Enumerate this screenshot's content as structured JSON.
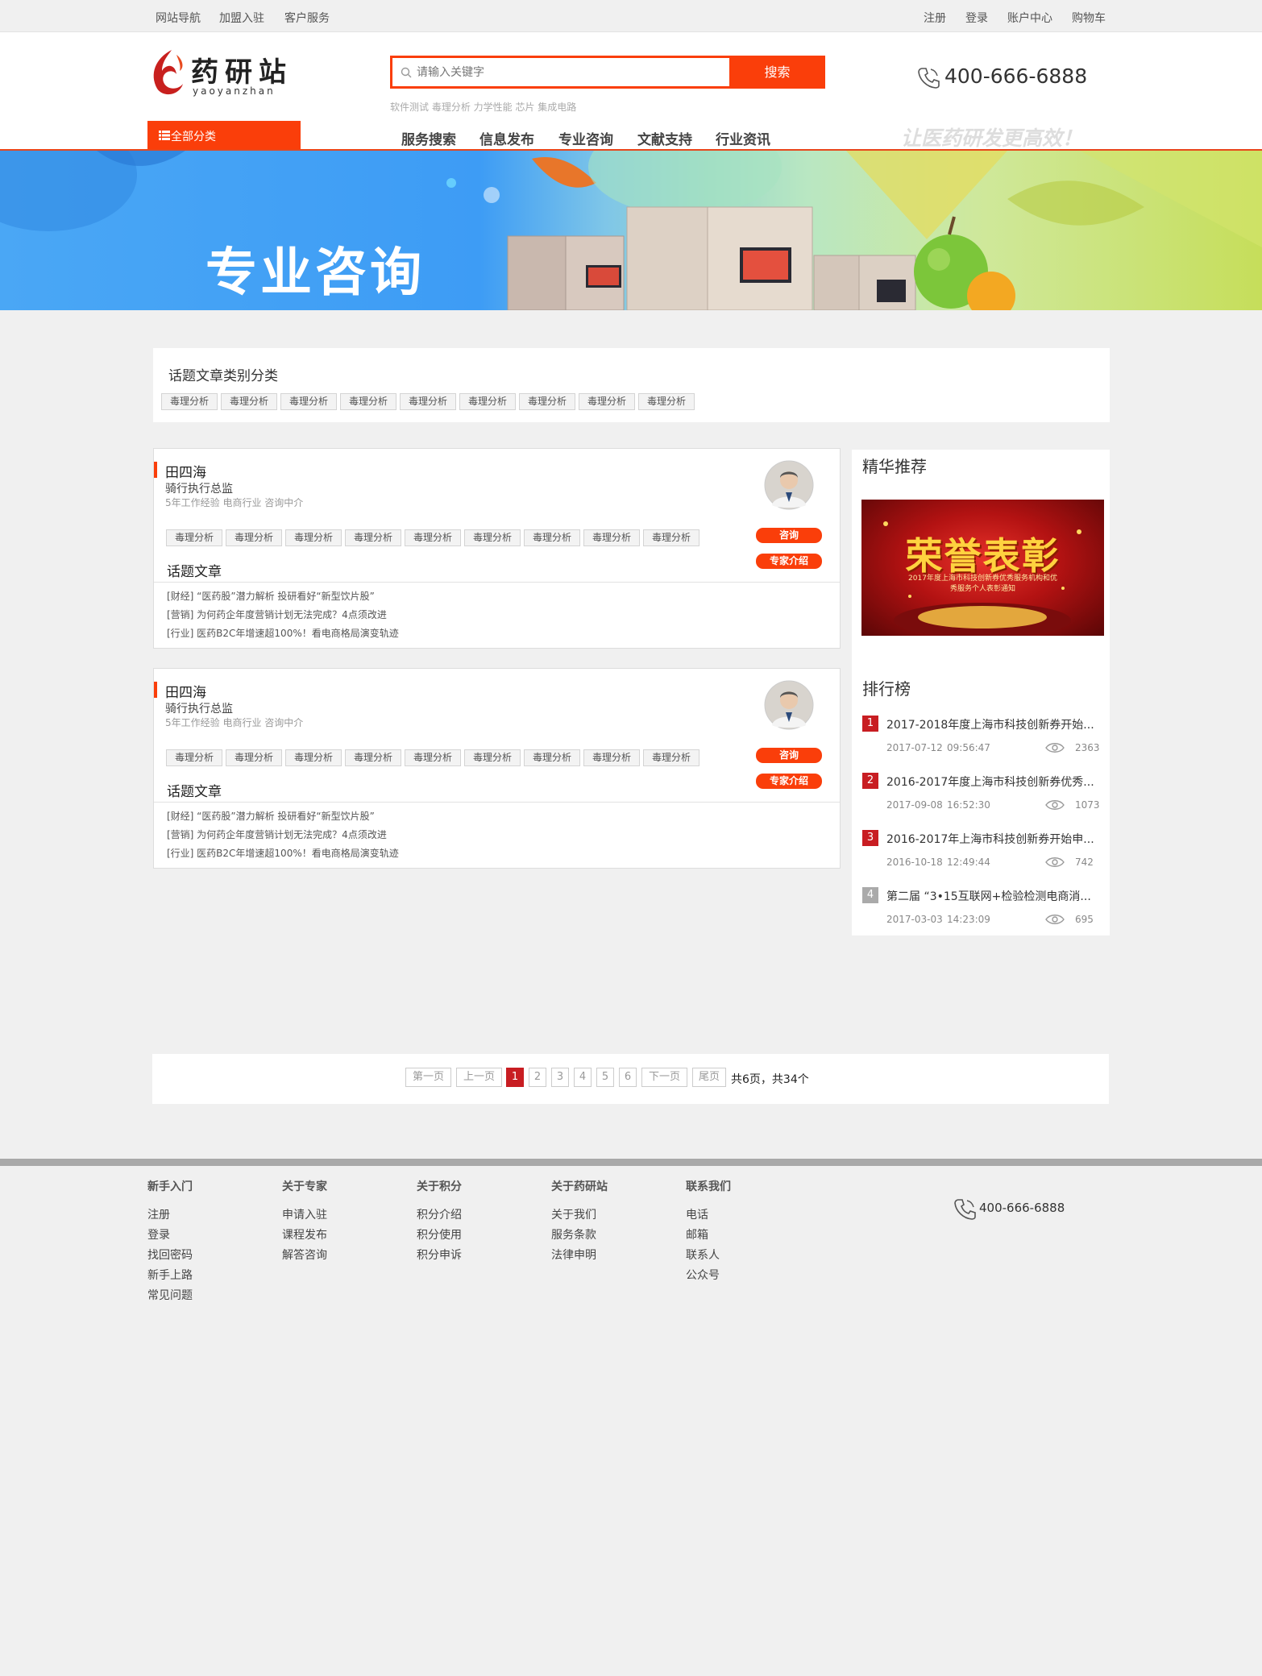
{
  "topbar": {
    "left": [
      "网站导航",
      "加盟入驻",
      "客户服务"
    ],
    "right": [
      "注册",
      "登录",
      "账户中心",
      "购物车"
    ]
  },
  "header": {
    "logo_cn": "药研站",
    "logo_en": "yaoyanzhan",
    "search_placeholder": "请输入关键字",
    "search_button": "搜索",
    "hot_keywords": "软件测试 毒理分析 力学性能 芯片 集成电路",
    "phone": "400-666-6888",
    "slogan": "让医药研发更高效！",
    "all_categories": "全部分类",
    "nav": [
      "服务搜索",
      "信息发布",
      "专业咨询",
      "文献支持",
      "行业资讯"
    ]
  },
  "banner": {
    "title": "专业咨询"
  },
  "category_box": {
    "title": "话题文章类别分类",
    "tags": [
      "毒理分析",
      "毒理分析",
      "毒理分析",
      "毒理分析",
      "毒理分析",
      "毒理分析",
      "毒理分析",
      "毒理分析",
      "毒理分析"
    ]
  },
  "experts": [
    {
      "name": "田四海",
      "title": "骑行执行总监",
      "meta": "5年工作经验 电商行业 咨询中介",
      "tags": [
        "毒理分析",
        "毒理分析",
        "毒理分析",
        "毒理分析",
        "毒理分析",
        "毒理分析",
        "毒理分析",
        "毒理分析",
        "毒理分析"
      ],
      "consult": "咨询",
      "intro": "专家介绍",
      "articles_title": "话题文章",
      "articles": [
        "[财经] “医药股”潜力解析 投研看好“新型饮片股”",
        "[营销] 为何药企年度营销计划无法完成？4点须改进",
        "[行业] 医药B2C年增速超100%！看电商格局演变轨迹"
      ]
    },
    {
      "name": "田四海",
      "title": "骑行执行总监",
      "meta": "5年工作经验 电商行业 咨询中介",
      "tags": [
        "毒理分析",
        "毒理分析",
        "毒理分析",
        "毒理分析",
        "毒理分析",
        "毒理分析",
        "毒理分析",
        "毒理分析",
        "毒理分析"
      ],
      "consult": "咨询",
      "intro": "专家介绍",
      "articles_title": "话题文章",
      "articles": [
        "[财经] “医药股”潜力解析 投研看好“新型饮片股”",
        "[营销] 为何药企年度营销计划无法完成？4点须改进",
        "[行业] 医药B2C年增速超100%！看电商格局演变轨迹"
      ]
    }
  ],
  "sidebar": {
    "featured_title": "精华推荐",
    "featured_banner_text": "荣誉表彰",
    "featured_banner_sub": "2017年度上海市科技创新券优秀服务机构和优秀服务个人表彰通知",
    "ranking_title": "排行榜",
    "ranking": [
      {
        "rank": "1",
        "title": "2017-2018年度上海市科技创新券开始...",
        "date": "2017-07-12",
        "time": "09:56:47",
        "views": "2363"
      },
      {
        "rank": "2",
        "title": "2016-2017年度上海市科技创新券优秀...",
        "date": "2017-09-08",
        "time": "16:52:30",
        "views": "1073"
      },
      {
        "rank": "3",
        "title": "2016-2017年上海市科技创新券开始申...",
        "date": "2016-10-18",
        "time": "12:49:44",
        "views": "742"
      },
      {
        "rank": "4",
        "title": "第二届 “3•15互联网+检验检测电商消...",
        "date": "2017-03-03",
        "time": "14:23:09",
        "views": "695"
      }
    ],
    "rank_colors": [
      "#c81d22",
      "#c81d22",
      "#c81d22",
      "#aaaaaa"
    ]
  },
  "pagination": {
    "first": "第一页",
    "prev": "上一页",
    "pages": [
      "1",
      "2",
      "3",
      "4",
      "5",
      "6"
    ],
    "next": "下一页",
    "last": "尾页",
    "summary": "共6页，共34个"
  },
  "footer": {
    "columns": [
      {
        "title": "新手入门",
        "links": [
          "注册",
          "登录",
          "找回密码",
          "新手上路",
          "常见问题"
        ]
      },
      {
        "title": "关于专家",
        "links": [
          "申请入驻",
          "课程发布",
          "解答咨询"
        ]
      },
      {
        "title": "关于积分",
        "links": [
          "积分介绍",
          "积分使用",
          "积分申诉"
        ]
      },
      {
        "title": "关于药研站",
        "links": [
          "关于我们",
          "服务条款",
          "法律申明"
        ]
      },
      {
        "title": "联系我们",
        "links": [
          "电话",
          "邮箱",
          "联系人",
          "公众号"
        ]
      }
    ],
    "phone": "400-666-6888"
  },
  "colors": {
    "accent": "#fa3e0a",
    "rank_red": "#c81d22"
  }
}
